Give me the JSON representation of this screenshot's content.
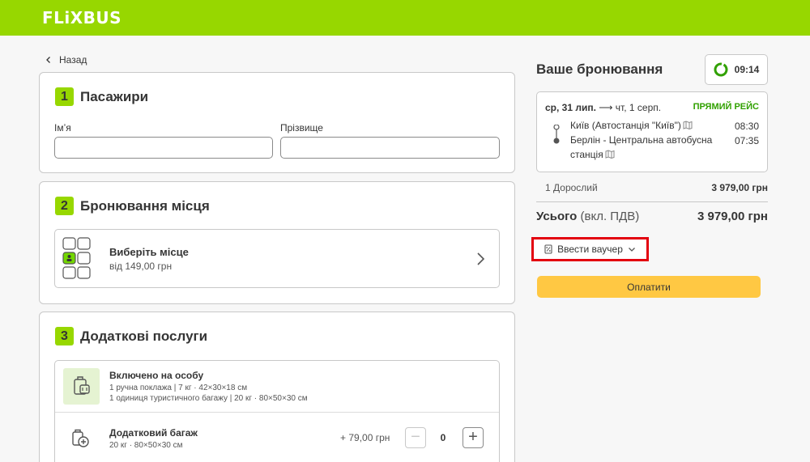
{
  "header": {
    "logo": "FLiXBUS"
  },
  "nav": {
    "back_label": "Назад"
  },
  "passengers": {
    "step": "1",
    "title": "Пасажири",
    "first_name_label": "Імʼя",
    "last_name_label": "Прізвище",
    "first_name_value": "",
    "last_name_value": ""
  },
  "seat": {
    "step": "2",
    "title": "Бронювання місця",
    "choose_label": "Виберіть місце",
    "price_label": "від 149,00 грн"
  },
  "services": {
    "step": "3",
    "title": "Додаткові послуги",
    "included_title": "Включено на особу",
    "included_line1": "1 ручна поклажа | 7 кг · 42×30×18 см",
    "included_line2": "1 одиниця туристичного багажу | 20 кг · 80×50×30 см",
    "extra_title": "Додатковий багаж",
    "extra_sub": "20 кг · 80×50×30 см",
    "extra_price": "+ 79,00 грн",
    "extra_qty": "0",
    "minus": "−",
    "plus": "+"
  },
  "booking": {
    "title": "Ваше бронювання",
    "timer": "09:14",
    "date_bold": "ср, 31 лип.",
    "date_rest": " ⟶ чт, 1 серп.",
    "direct_label": "ПРЯМИЙ РЕЙС",
    "from_stop": "Київ (Автостанція \"Київ\")",
    "from_time": "08:30",
    "to_stop": "Берлін - Центральна автобусна станція",
    "to_time": "07:35",
    "passenger_row": "1 Дорослий",
    "passenger_price": "3 979,00 грн",
    "total_label": "Усього",
    "total_vat": "(вкл. ПДВ)",
    "total_value": "3 979,00 грн",
    "voucher_label": "Ввести ваучер",
    "pay_label": "Оплатити"
  },
  "colors": {
    "brand": "#97d700",
    "cta": "#ffc843",
    "direct": "#31a100",
    "highlight": "#e3000f"
  }
}
